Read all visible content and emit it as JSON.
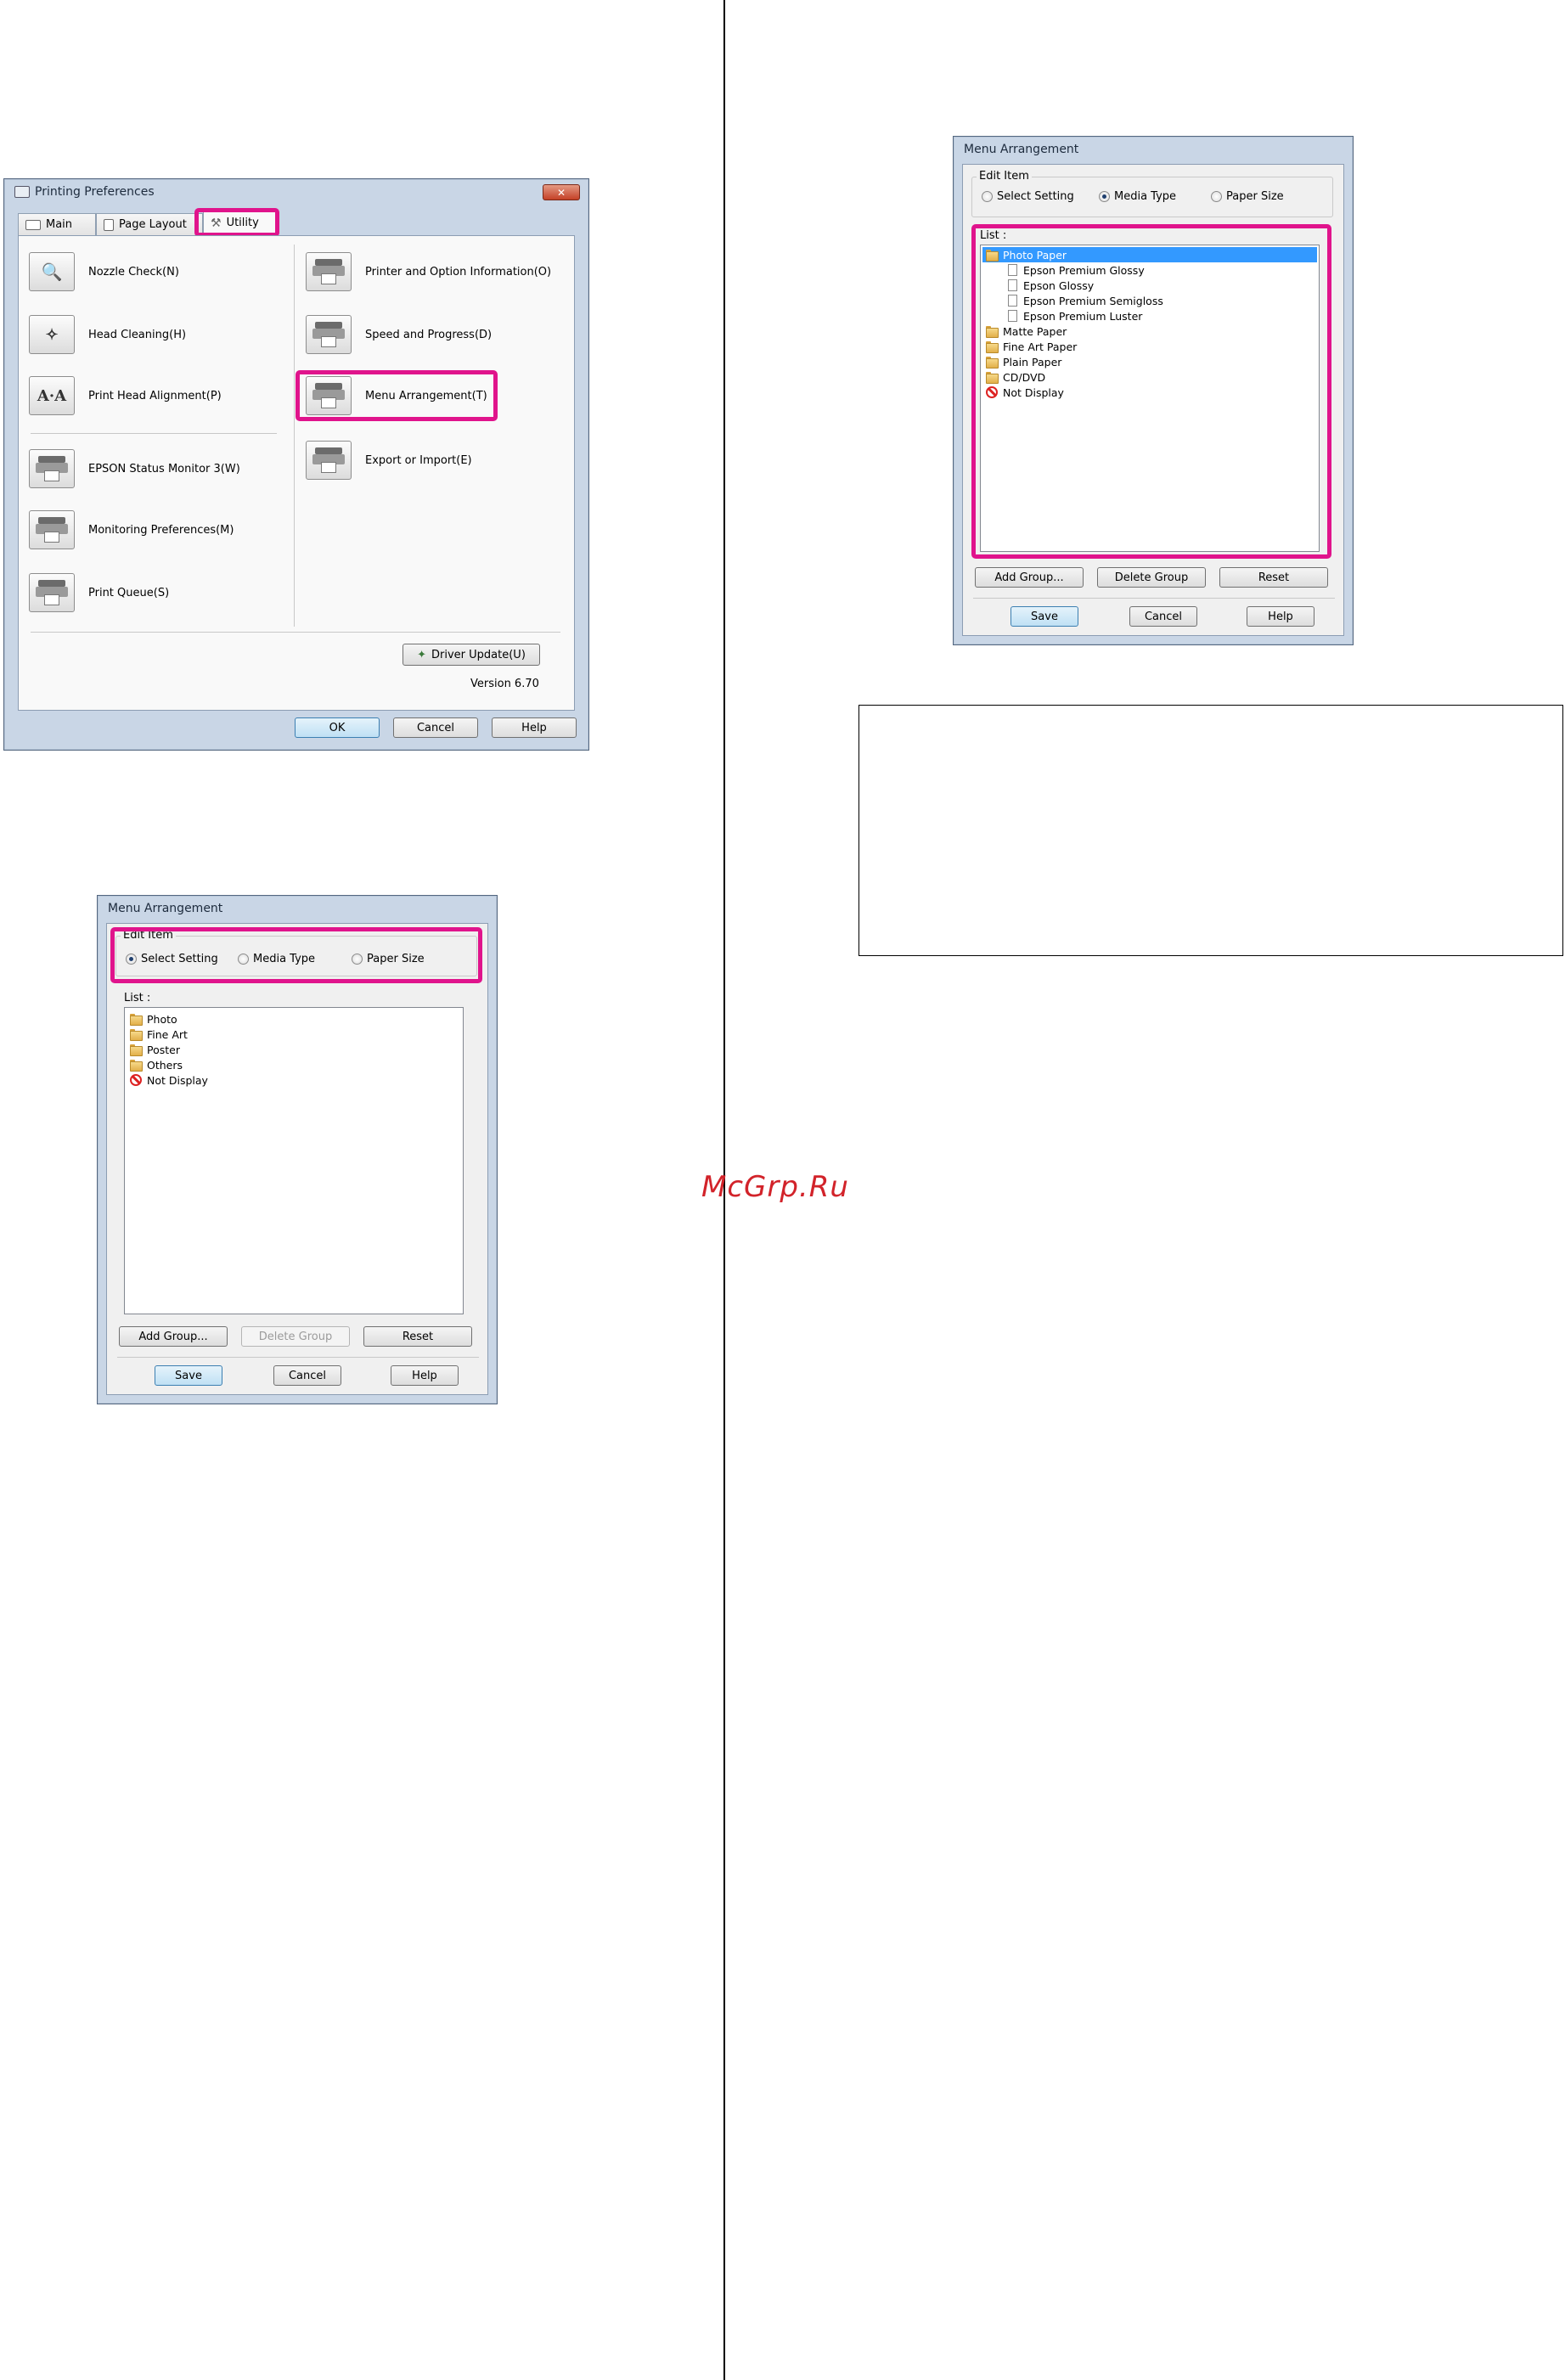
{
  "watermark": "McGrp.Ru",
  "printing_preferences": {
    "title": "Printing Preferences",
    "close_glyph": "✕",
    "tabs": [
      {
        "label": "Main",
        "icon": "printer-icon"
      },
      {
        "label": "Page Layout",
        "icon": "page-icon"
      },
      {
        "label": "Utility",
        "icon": "wrench-icon"
      }
    ],
    "left_items": [
      {
        "label": "Nozzle Check(N)",
        "icon": "nozzle-check-icon"
      },
      {
        "label": "Head Cleaning(H)",
        "icon": "head-cleaning-icon"
      },
      {
        "label": "Print Head Alignment(P)",
        "icon": "alignment-icon",
        "glyph": "A·A"
      },
      {
        "label": "EPSON Status Monitor 3(W)",
        "icon": "status-monitor-icon"
      },
      {
        "label": "Monitoring Preferences(M)",
        "icon": "monitoring-prefs-icon"
      },
      {
        "label": "Print Queue(S)",
        "icon": "print-queue-icon"
      }
    ],
    "right_items": [
      {
        "label": "Printer and Option Information(O)",
        "icon": "printer-info-icon"
      },
      {
        "label": "Speed and Progress(D)",
        "icon": "speed-progress-icon"
      },
      {
        "label": "Menu Arrangement(T)",
        "icon": "menu-arrangement-icon"
      },
      {
        "label": "Export or Import(E)",
        "icon": "export-import-icon"
      }
    ],
    "driver_update": "Driver Update(U)",
    "version": "Version 6.70",
    "ok": "OK",
    "cancel": "Cancel",
    "help": "Help"
  },
  "menu_arrangement_1": {
    "title": "Menu Arrangement",
    "edit_item_label": "Edit Item",
    "radios": [
      {
        "label": "Select Setting",
        "checked": true
      },
      {
        "label": "Media Type",
        "checked": false
      },
      {
        "label": "Paper Size",
        "checked": false
      }
    ],
    "list_label": "List :",
    "items": [
      {
        "label": "Photo",
        "type": "folder"
      },
      {
        "label": "Fine Art",
        "type": "folder"
      },
      {
        "label": "Poster",
        "type": "folder"
      },
      {
        "label": "Others",
        "type": "folder"
      },
      {
        "label": "Not Display",
        "type": "not-display"
      }
    ],
    "add_group": "Add Group...",
    "delete_group": "Delete Group",
    "reset": "Reset",
    "save": "Save",
    "cancel": "Cancel",
    "help": "Help"
  },
  "menu_arrangement_2": {
    "title": "Menu Arrangement",
    "edit_item_label": "Edit Item",
    "radios": [
      {
        "label": "Select Setting",
        "checked": false
      },
      {
        "label": "Media Type",
        "checked": true
      },
      {
        "label": "Paper Size",
        "checked": false
      }
    ],
    "list_label": "List :",
    "items": [
      {
        "label": "Photo Paper",
        "type": "folder",
        "selected": true
      },
      {
        "label": "Epson Premium Glossy",
        "type": "doc"
      },
      {
        "label": "Epson Glossy",
        "type": "doc"
      },
      {
        "label": "Epson Premium Semigloss",
        "type": "doc"
      },
      {
        "label": "Epson Premium Luster",
        "type": "doc"
      },
      {
        "label": "Matte Paper",
        "type": "folder"
      },
      {
        "label": "Fine Art Paper",
        "type": "folder"
      },
      {
        "label": "Plain Paper",
        "type": "folder"
      },
      {
        "label": "CD/DVD",
        "type": "folder"
      },
      {
        "label": "Not Display",
        "type": "not-display"
      }
    ],
    "add_group": "Add Group...",
    "delete_group": "Delete Group",
    "reset": "Reset",
    "save": "Save",
    "cancel": "Cancel",
    "help": "Help"
  },
  "colors": {
    "highlight": "#e0148c",
    "selection": "#3399ff",
    "watermark": "#d2232a"
  }
}
